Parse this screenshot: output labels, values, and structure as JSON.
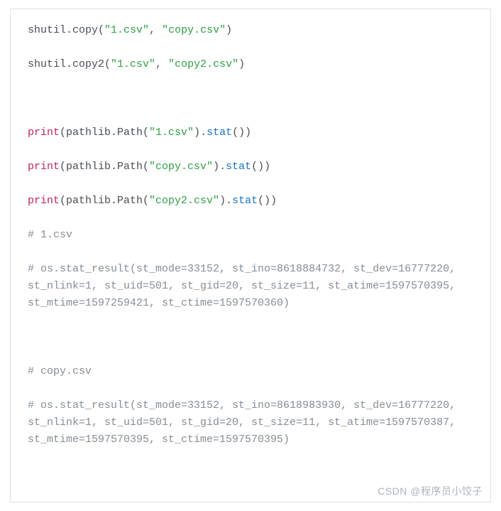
{
  "code": {
    "line1": {
      "p1": "shutil.copy(",
      "str1": "\"1.csv\"",
      "comma": ", ",
      "str2": "\"copy.csv\"",
      "close": ")"
    },
    "line2": {
      "p1": "shutil.copy2(",
      "str1": "\"1.csv\"",
      "comma": ", ",
      "str2": "\"copy2.csv\"",
      "close": ")"
    },
    "line3": {
      "func": "print",
      "p1": "(pathlib.Path(",
      "str1": "\"1.csv\"",
      "p2": ").",
      "method": "stat",
      "close": "())"
    },
    "line4": {
      "func": "print",
      "p1": "(pathlib.Path(",
      "str1": "\"copy.csv\"",
      "p2": ").",
      "method": "stat",
      "close": "())"
    },
    "line5": {
      "func": "print",
      "p1": "(pathlib.Path(",
      "str1": "\"copy2.csv\"",
      "p2": ").",
      "method": "stat",
      "close": "())"
    },
    "comment1": "# 1.csv",
    "comment2": "# os.stat_result(st_mode=33152, st_ino=8618884732, st_dev=16777220, st_nlink=1, st_uid=501, st_gid=20, st_size=11, st_atime=1597570395, st_mtime=1597259421, st_ctime=1597570360)",
    "comment3": "# copy.csv",
    "comment4": "# os.stat_result(st_mode=33152, st_ino=8618983930, st_dev=16777220, st_nlink=1, st_uid=501, st_gid=20, st_size=11, st_atime=1597570387, st_mtime=1597570395, st_ctime=1597570395)"
  },
  "watermark": "CSDN @程序员小饺子"
}
